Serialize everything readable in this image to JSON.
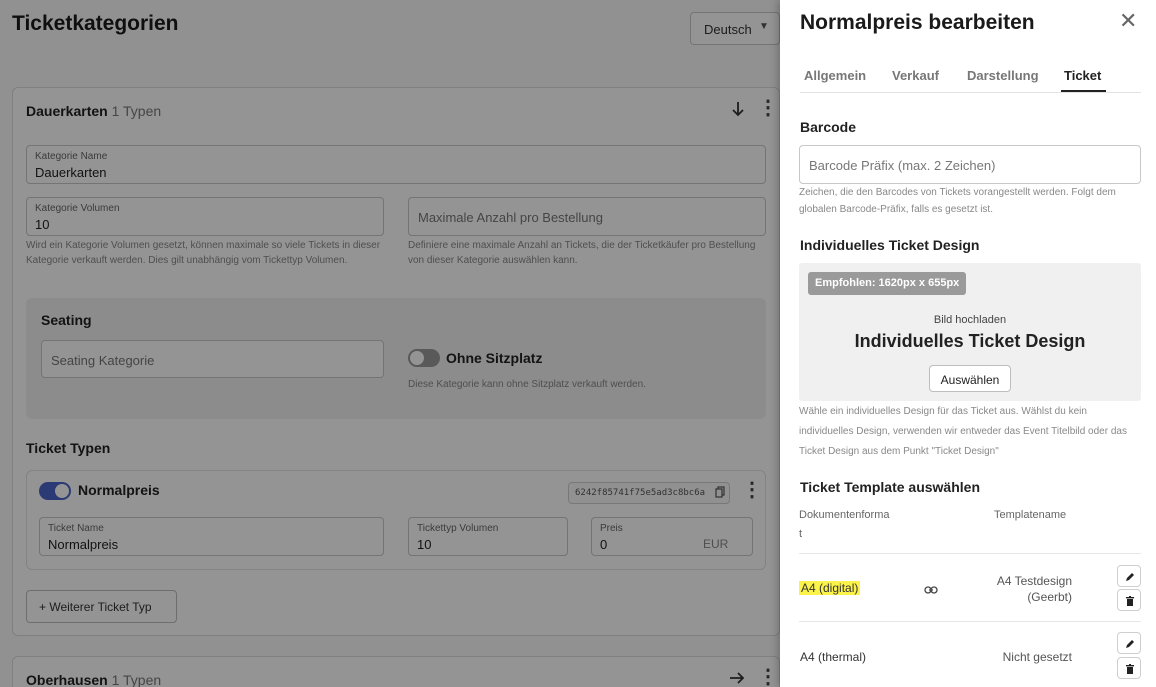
{
  "page": {
    "title": "Ticketkategorien",
    "language": "Deutsch"
  },
  "category1": {
    "name": "Dauerkarten",
    "type_count": "1 Typen",
    "name_label": "Kategorie Name",
    "name_value": "Dauerkarten",
    "volume_label": "Kategorie Volumen",
    "volume_value": "10",
    "volume_help": "Wird ein Kategorie Volumen gesetzt, können maximale so viele Tickets in dieser Kategorie verkauft werden. Dies gilt unabhängig vom Tickettyp Volumen.",
    "max_placeholder": "Maximale Anzahl pro Bestellung",
    "max_help": "Definiere eine maximale Anzahl an Tickets, die der Ticketkäufer pro Bestellung von dieser Kategorie auswählen kann.",
    "seating_title": "Seating",
    "seating_placeholder": "Seating Kategorie",
    "no_seat_label": "Ohne Sitzplatz",
    "no_seat_help": "Diese Kategorie kann ohne Sitzplatz verkauft werden.",
    "ticket_types_title": "Ticket Typen",
    "ticket": {
      "name": "Normalpreis",
      "code": "6242f85741f75e5ad3c8bc6a",
      "name_label": "Ticket Name",
      "name_value": "Normalpreis",
      "volume_label": "Tickettyp Volumen",
      "volume_value": "10",
      "price_label": "Preis",
      "price_value": "0",
      "currency": "EUR"
    },
    "add_type_label": "+ Weiterer Ticket Typ"
  },
  "category2": {
    "name": "Oberhausen",
    "type_count": "1 Typen"
  },
  "drawer": {
    "title": "Normalpreis bearbeiten",
    "tabs": [
      "Allgemein",
      "Verkauf",
      "Darstellung",
      "Ticket"
    ],
    "active_tab": "Ticket",
    "barcode_title": "Barcode",
    "barcode_placeholder": "Barcode Präfix (max. 2 Zeichen)",
    "barcode_help": "Zeichen, die den Barcodes von Tickets vorangestellt werden. Folgt dem globalen Barcode-Präfix, falls es gesetzt ist.",
    "design_title": "Individuelles Ticket Design",
    "design_badge": "Empfohlen: 1620px x 655px",
    "upload_small": "Bild hochladen",
    "upload_large": "Individuelles Ticket Design",
    "choose_label": "Auswählen",
    "design_help": "Wähle ein individuelles Design für das Ticket aus. Wählst du kein individuelles Design, verwenden wir entweder das Event Titelbild oder das Ticket Design aus dem Punkt \"Ticket Design\"",
    "template_title": "Ticket Template auswählen",
    "col_format": "Dokumentenforma",
    "col_format_wrap": "t",
    "col_template": "Templatename",
    "rows": [
      {
        "format": "A4 (digital)",
        "template_line1": "A4 Testdesign",
        "template_line2": "(Geerbt)"
      },
      {
        "format": "A4 (thermal)",
        "template_line1": "Nicht gesetzt"
      }
    ]
  },
  "colors": {
    "highlight": "#fbf24a",
    "toggle_on": "#4a63c8"
  }
}
